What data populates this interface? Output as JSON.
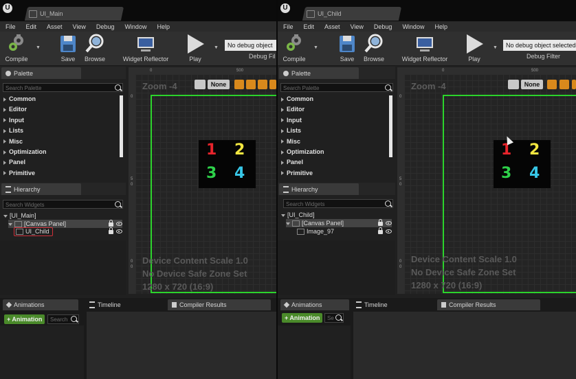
{
  "left": {
    "doc_tab": "UI_Main",
    "menu": [
      "File",
      "Edit",
      "Asset",
      "View",
      "Debug",
      "Window",
      "Help"
    ],
    "toolbar": {
      "compile": "Compile",
      "save": "Save",
      "browse": "Browse",
      "widget_reflector": "Widget Reflector",
      "play": "Play",
      "debug_object": "No debug object",
      "debug_filter": "Debug Fil"
    },
    "palette": {
      "title": "Palette",
      "search_placeholder": "Search Palette",
      "items": [
        "Common",
        "Editor",
        "Input",
        "Lists",
        "Misc",
        "Optimization",
        "Panel",
        "Primitive"
      ]
    },
    "hierarchy": {
      "title": "Hierarchy",
      "search_placeholder": "Search Widgets",
      "root": "[UI_Main]",
      "canvas": "[Canvas Panel]",
      "child": "UI_Child"
    },
    "designer": {
      "zoom": "Zoom -4",
      "none_btn": "None",
      "ruler_x0": "0",
      "ruler_x1": "500",
      "ruler_y0": "0",
      "ruler_y1": "5",
      "ruler_y2": "0",
      "ruler_y3": "0",
      "ruler_y4": "0",
      "info_line1": "Device Content Scale 1.0",
      "info_line2": "No Device Safe Zone Set",
      "info_line3": "1280 x 720 (16:9)"
    },
    "bottom": {
      "animations": "Animations",
      "timeline": "Timeline",
      "compiler_results": "Compiler Results",
      "add_animation": "+ Animation",
      "search": "Search"
    }
  },
  "right": {
    "doc_tab": "UI_Child",
    "menu": [
      "File",
      "Edit",
      "Asset",
      "View",
      "Debug",
      "Window",
      "Help"
    ],
    "toolbar": {
      "compile": "Compile",
      "save": "Save",
      "browse": "Browse",
      "widget_reflector": "Widget Reflector",
      "play": "Play",
      "debug_object": "No debug object selected",
      "debug_filter": "Debug Filter"
    },
    "palette": {
      "title": "Palette",
      "search_placeholder": "Search Palette",
      "items": [
        "Common",
        "Editor",
        "Input",
        "Lists",
        "Misc",
        "Optimization",
        "Panel",
        "Primitive"
      ]
    },
    "hierarchy": {
      "title": "Hierarchy",
      "search_placeholder": "Search Widgets",
      "root": "[UI_Child]",
      "canvas": "[Canvas Panel]",
      "child": "Image_97"
    },
    "designer": {
      "zoom": "Zoom -4",
      "none_btn": "None",
      "ruler_x0": "0",
      "ruler_x1": "500",
      "ruler_y0": "0",
      "ruler_y1": "5",
      "ruler_y2": "0",
      "ruler_y3": "0",
      "ruler_y4": "0",
      "info_line1": "Device Content Scale 1.0",
      "info_line2": "No Device Safe Zone Set",
      "info_line3": "1280 x 720 (16:9)"
    },
    "bottom": {
      "animations": "Animations",
      "timeline": "Timeline",
      "compiler_results": "Compiler Results",
      "add_animation": "+ Animation",
      "search": "Se"
    }
  },
  "grid_numbers": [
    "1",
    "2",
    "3",
    "4"
  ],
  "grid_number_colors": [
    "#e8242c",
    "#f2e640",
    "#2ed14a",
    "#37c6e6"
  ],
  "colors": {
    "frame_green": "#2cd42c",
    "selection_red": "#d0303a",
    "orange_tool": "#d9891c",
    "add_button_green": "#4a8a2a"
  }
}
